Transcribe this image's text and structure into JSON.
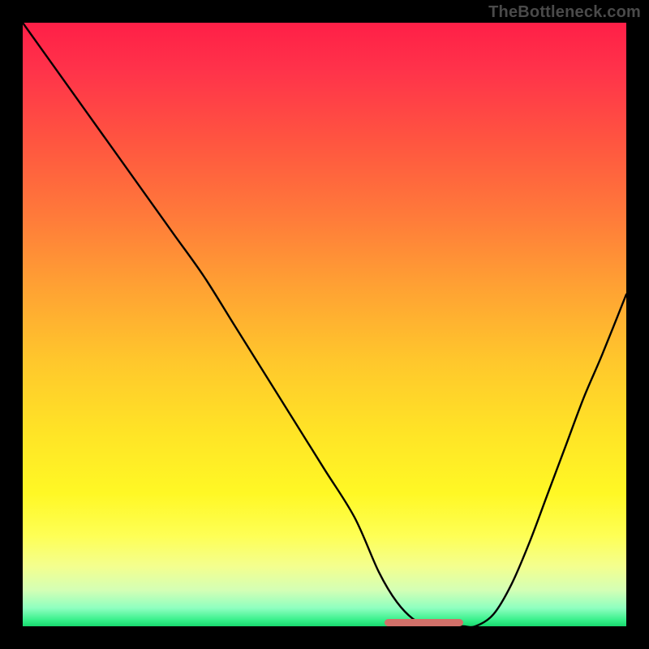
{
  "watermark": "TheBottleneck.com",
  "chart_data": {
    "type": "line",
    "title": "",
    "xlabel": "",
    "ylabel": "",
    "xlim": [
      0,
      100
    ],
    "ylim": [
      0,
      100
    ],
    "x": [
      0,
      5,
      10,
      15,
      20,
      25,
      30,
      35,
      40,
      45,
      50,
      55,
      59,
      62,
      65,
      68,
      71,
      73,
      75,
      78,
      81,
      84,
      87,
      90,
      93,
      96,
      100
    ],
    "values": [
      100,
      93,
      86,
      79,
      72,
      65,
      58,
      50,
      42,
      34,
      26,
      18,
      9,
      4,
      1,
      0,
      0,
      0,
      0,
      2,
      7,
      14,
      22,
      30,
      38,
      45,
      55
    ],
    "flat_region_x": [
      60,
      73
    ],
    "gradient_stops": [
      {
        "pos": 0,
        "color": "#ff1f47"
      },
      {
        "pos": 50,
        "color": "#ffc72c"
      },
      {
        "pos": 90,
        "color": "#f4ff8e"
      },
      {
        "pos": 100,
        "color": "#18d86e"
      }
    ]
  }
}
